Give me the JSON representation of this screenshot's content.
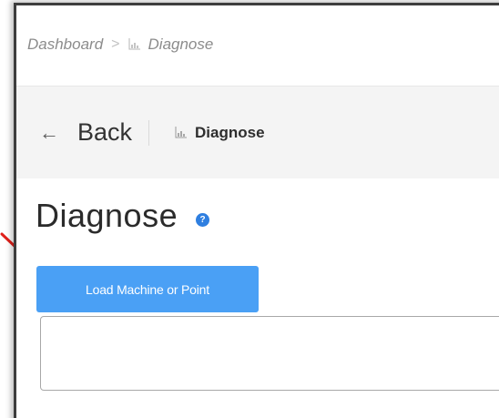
{
  "breadcrumb": {
    "root": "Dashboard",
    "separator": ">",
    "current": "Diagnose"
  },
  "toolbar": {
    "back_icon": "arrow-left-icon",
    "back_label": "Back",
    "title_icon": "chart-icon",
    "title": "Diagnose"
  },
  "page": {
    "title": "Diagnose",
    "help_icon": "help-icon",
    "help_glyph": "?"
  },
  "actions": {
    "load_button_label": "Load Machine or Point"
  },
  "colors": {
    "accent": "#4aa0f5",
    "help": "#2f7fe0",
    "annotation": "#e0201a",
    "toolbar_bg": "#f4f4f4"
  }
}
